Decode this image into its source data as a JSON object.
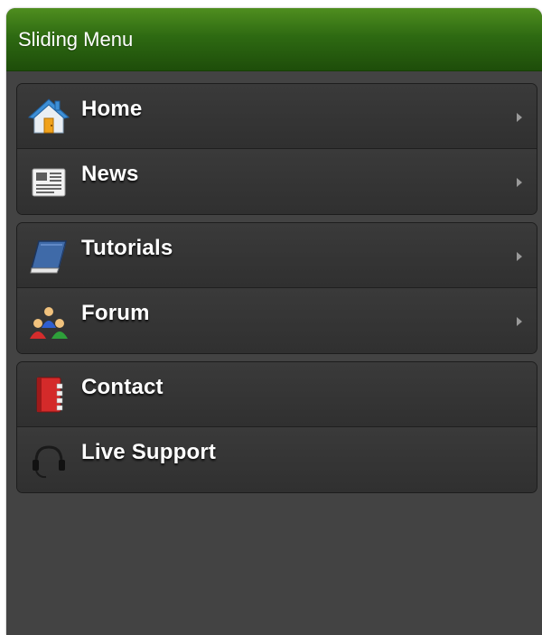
{
  "header": {
    "title": "Sliding Menu"
  },
  "groups": [
    {
      "items": [
        {
          "label": "Home",
          "icon": "home-icon",
          "has_submenu": true
        },
        {
          "label": "News",
          "icon": "newspaper-icon",
          "has_submenu": true
        }
      ]
    },
    {
      "items": [
        {
          "label": "Tutorials",
          "icon": "book-icon",
          "has_submenu": true
        },
        {
          "label": "Forum",
          "icon": "users-icon",
          "has_submenu": true
        }
      ]
    },
    {
      "items": [
        {
          "label": "Contact",
          "icon": "address-book-icon",
          "has_submenu": false
        },
        {
          "label": "Live Support",
          "icon": "headset-icon",
          "has_submenu": false
        }
      ]
    }
  ],
  "colors": {
    "header_green": "#2e6a12",
    "panel_bg": "#434343",
    "item_bg": "#333333",
    "text": "#ffffff",
    "chevron": "#9a9a9a"
  }
}
